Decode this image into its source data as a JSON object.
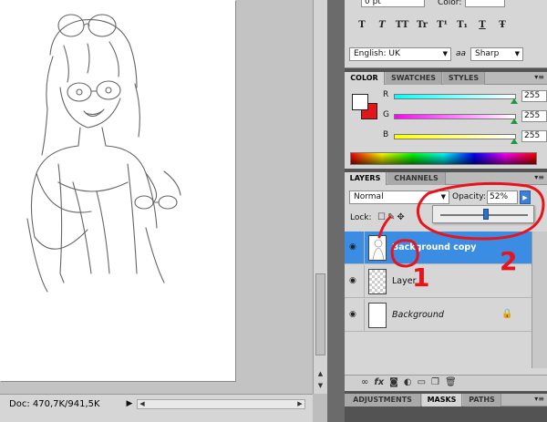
{
  "character_panel": {
    "leading_value": "0 pt",
    "color_label": "Color:",
    "type_buttons": [
      "T",
      "T",
      "TT",
      "Tr",
      "T¹",
      "T₁",
      "T",
      "Ŧ"
    ],
    "language": "English: UK",
    "aa_icon": "aa",
    "antialias": "Sharp"
  },
  "color_panel": {
    "tabs": [
      "COLOR",
      "SWATCHES",
      "STYLES"
    ],
    "foreground": "#ffffff",
    "background": "#e0161a",
    "sliders": [
      {
        "label": "R",
        "value": "255",
        "gradient": "linear-gradient(to right, #00ffff, #ffffff)"
      },
      {
        "label": "G",
        "value": "255",
        "gradient": "linear-gradient(to right, #ff00ff, #ffffff)"
      },
      {
        "label": "B",
        "value": "255",
        "gradient": "linear-gradient(to right, #ffff00, #ffffff)"
      }
    ]
  },
  "layers_panel": {
    "tabs": [
      "LAYERS",
      "CHANNELS"
    ],
    "blend_mode": "Normal",
    "opacity_label": "Opacity:",
    "opacity_value": "52%",
    "opacity_fraction": 0.52,
    "lock_label": "Lock:",
    "layers": [
      {
        "name": "Background copy",
        "selected": true,
        "thumb": "sketch"
      },
      {
        "name": "Layer 1",
        "selected": false,
        "thumb": "checker"
      },
      {
        "name": "Background",
        "selected": false,
        "thumb": "white",
        "locked": true
      }
    ],
    "footer_icons": [
      "link-icon",
      "fx-icon",
      "mask-icon",
      "adjustment-icon",
      "group-icon",
      "new-layer-icon",
      "trash-icon"
    ]
  },
  "bottom_tabs": [
    "ADJUSTMENTS",
    "MASKS",
    "PATHS"
  ],
  "status_bar": {
    "doc_info": "Doc: 470,7K/941,5K"
  },
  "annotations": {
    "color": "#e8141b",
    "labels": [
      "1",
      "2"
    ]
  }
}
